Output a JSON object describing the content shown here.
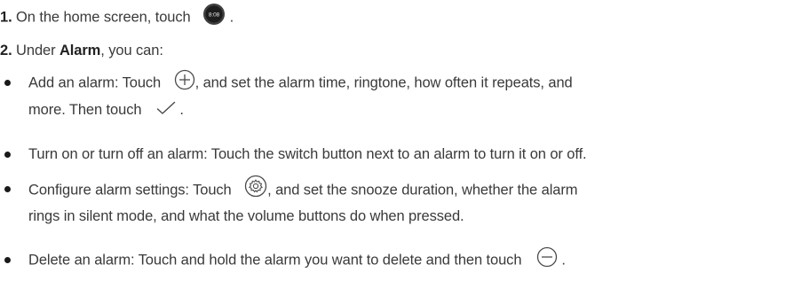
{
  "steps": [
    {
      "number": "1.",
      "text_before": "On the home screen, touch",
      "icon": "clock-app-icon",
      "icon_label": "8:08",
      "text_after": "."
    },
    {
      "number": "2.",
      "text_before": "Under",
      "bold": "Alarm",
      "text_after": ", you can:"
    }
  ],
  "bullets": [
    {
      "line1_before": "Add an alarm: Touch",
      "icon1": "add-circle-icon",
      "line1_after": ", and set the alarm time, ringtone, how often it repeats, and",
      "line2_before": "more. Then touch",
      "icon2": "checkmark-icon",
      "line2_after": "."
    },
    {
      "line1": "Turn on or turn off an alarm: Touch the switch button next to an alarm to turn it on or off."
    },
    {
      "line1_before": "Configure alarm settings: Touch",
      "icon1": "gear-circle-icon",
      "line1_after": ", and set the snooze duration, whether the alarm",
      "line2": "rings in silent mode, and what the volume buttons do when pressed."
    },
    {
      "line1_before": "Delete an alarm: Touch and hold the alarm you want to delete and then touch",
      "icon1": "minus-circle-icon",
      "line1_after": "."
    }
  ]
}
